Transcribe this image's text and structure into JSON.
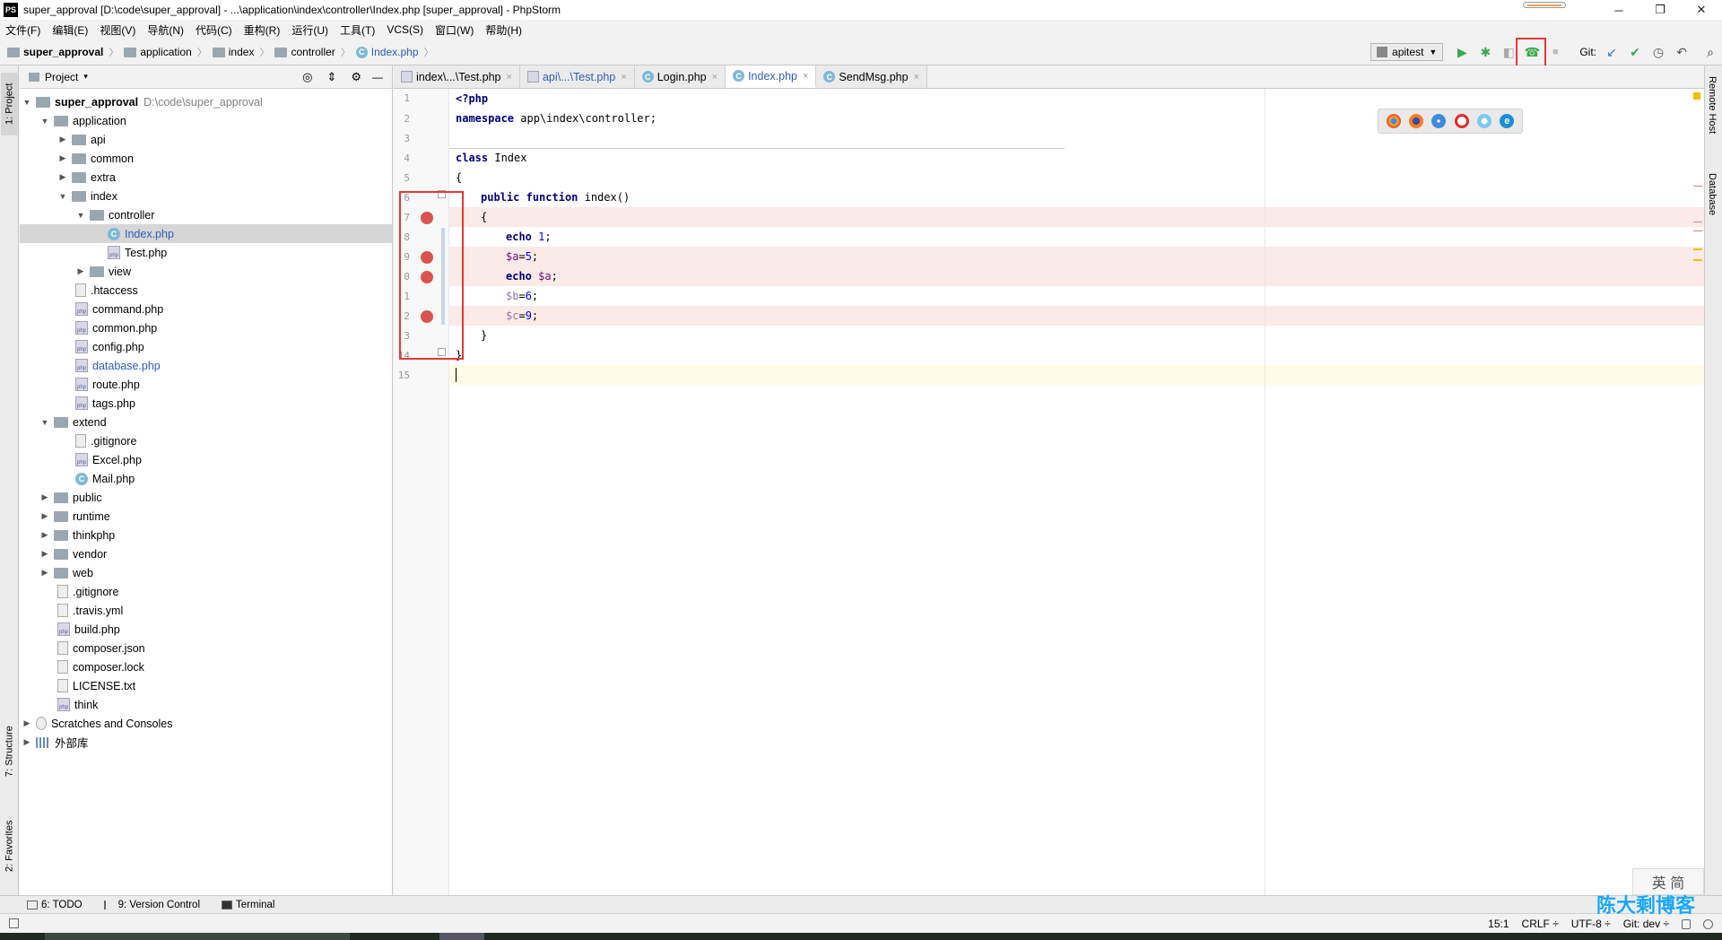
{
  "window": {
    "title": "super_approval [D:\\code\\super_approval] - ...\\application\\index\\controller\\Index.php [super_approval] - PhpStorm",
    "app_badge": "PS",
    "minimize": "─",
    "maximize": "❐",
    "close": "✕"
  },
  "menu": [
    "文件(F)",
    "编辑(E)",
    "视图(V)",
    "导航(N)",
    "代码(C)",
    "重构(R)",
    "运行(U)",
    "工具(T)",
    "VCS(S)",
    "窗口(W)",
    "帮助(H)"
  ],
  "breadcrumb": {
    "items": [
      "super_approval",
      "application",
      "index",
      "controller",
      "Index.php"
    ],
    "separator": "〉"
  },
  "toolbar": {
    "run_config": "apitest",
    "git_label": "Git:",
    "run_icon": "▶",
    "debug_icon": "✱",
    "coverage_icon": "◧",
    "listen_icon": "☎",
    "stop_icon": "■",
    "update_icon": "↙",
    "commit_icon": "✔",
    "history_icon": "◷",
    "revert_icon": "↶",
    "search_icon": "⌕"
  },
  "left_stripe": {
    "project": "1: Project",
    "structure": "7: Structure",
    "favorites": "2: Favorites"
  },
  "project_panel": {
    "title": "Project",
    "dropdown": "▾",
    "locate_icon": "◎",
    "collapse_icon": "⇕",
    "settings_icon": "⚙",
    "hide_icon": "—",
    "root": {
      "name": "super_approval",
      "path": "D:\\code\\super_approval"
    },
    "application": "application",
    "api": "api",
    "common": "common",
    "extra": "extra",
    "index": "index",
    "controller": "controller",
    "index_php": "Index.php",
    "test_php": "Test.php",
    "view": "view",
    "htaccess": ".htaccess",
    "command_php": "command.php",
    "common_php": "common.php",
    "config_php": "config.php",
    "database_php": "database.php",
    "route_php": "route.php",
    "tags_php": "tags.php",
    "extend": "extend",
    "gitignore": ".gitignore",
    "excel_php": "Excel.php",
    "mail_php": "Mail.php",
    "public": "public",
    "runtime": "runtime",
    "thinkphp": "thinkphp",
    "vendor": "vendor",
    "web": "web",
    "root_gitignore": ".gitignore",
    "travis": ".travis.yml",
    "build_php": "build.php",
    "composer_json": "composer.json",
    "composer_lock": "composer.lock",
    "license": "LICENSE.txt",
    "think": "think",
    "scratches": "Scratches and Consoles",
    "external_libs": "外部库"
  },
  "tabs": [
    {
      "label": "index\\...\\Test.php",
      "close": "×"
    },
    {
      "label": "api\\...\\Test.php",
      "close": "×"
    },
    {
      "label": "Login.php",
      "close": "×"
    },
    {
      "label": "Index.php",
      "close": "×"
    },
    {
      "label": "SendMsg.php",
      "close": "×"
    }
  ],
  "code": {
    "line_numbers": [
      "1",
      "2",
      "3",
      "4",
      "5",
      "6",
      "7",
      "8",
      "9",
      "0",
      "1",
      "2",
      "3",
      "14",
      "15"
    ],
    "php_open": "<?php",
    "namespace_kw": "namespace",
    "namespace_name": " app\\index\\controller;",
    "class_kw": "class",
    "class_name": " Index",
    "open_brace": "{",
    "public_kw": "public",
    "function_kw": "function",
    "fn_name": " index()",
    "fn_open": "{",
    "echo_kw": "echo",
    "echo_val": " 1",
    "semi": ";",
    "a_var": "$a",
    "a_assign": "=",
    "a_val": "5",
    "echo2_var": " $a",
    "b_var": "$b",
    "b_val": "6",
    "c_var": "$c",
    "c_val": "9",
    "fn_close": "}",
    "class_close": "}"
  },
  "browsers": [
    "chrome-icon",
    "firefox-icon",
    "safari-icon",
    "opera-icon",
    "ie-icon",
    "edge-icon"
  ],
  "right_stripe": {
    "remote_host": "Remote Host",
    "database": "Database"
  },
  "bottom_tools": [
    {
      "label": "6: TODO"
    },
    {
      "label": "9: Version Control"
    },
    {
      "label": "Terminal"
    }
  ],
  "status": {
    "position": "15:1",
    "line_sep": "CRLF ÷",
    "encoding": "UTF-8 ÷",
    "git_branch": "Git: dev ÷"
  },
  "ime": "英 简",
  "watermark": "陈大剩博客",
  "colors": {
    "breakpoint": "#d9534f",
    "highlight_box": "#e53935",
    "keyword": "#000080"
  }
}
